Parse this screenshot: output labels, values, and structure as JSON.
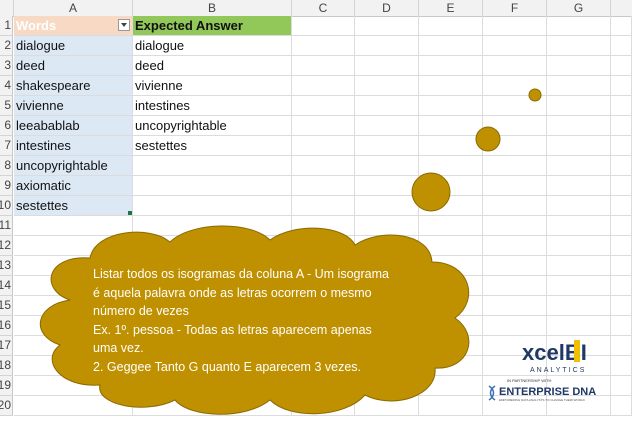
{
  "columns": [
    "A",
    "B",
    "C",
    "D",
    "E",
    "F",
    "G"
  ],
  "rows": [
    "1",
    "2",
    "3",
    "4",
    "5",
    "6",
    "7",
    "8",
    "9",
    "10",
    "11",
    "12",
    "13",
    "14",
    "15",
    "16",
    "17",
    "18",
    "19",
    "20"
  ],
  "header": {
    "words": "Words",
    "expected": "Expected Answer"
  },
  "words": [
    "dialogue",
    "deed",
    "shakespeare",
    "vivienne",
    "leeabablab",
    "intestines",
    "uncopyrightable",
    "axiomatic",
    "sestettes"
  ],
  "expected": [
    "dialogue",
    "deed",
    "vivienne",
    "intestines",
    "uncopyrightable",
    "sestettes"
  ],
  "note": {
    "line1": "Listar todos os isogramas da coluna A - Um isograma",
    "line2": "é aquela palavra onde as letras ocorrem o mesmo",
    "line3": "número de vezes",
    "line4": "Ex. 1º. pessoa - Todas as letras aparecem apenas",
    "line5": "uma vez.",
    "line6": "2. Geggee Tanto G quanto E aparecem 3 vezes."
  },
  "logo": {
    "brand": "xcelBI",
    "sub": "ANALYTICS",
    "partner": "IN PARTNERSHIP WITH",
    "dna": "ENTERPRISE DNA",
    "tagline": "EMPOWERING DATA ANALYSTS TO CHANGE THEIR WORLD"
  },
  "colors": {
    "cloud": "#bf9000",
    "header_words": "#f8d9c4",
    "header_expected": "#92c75a",
    "selection": "#dde8f5"
  }
}
